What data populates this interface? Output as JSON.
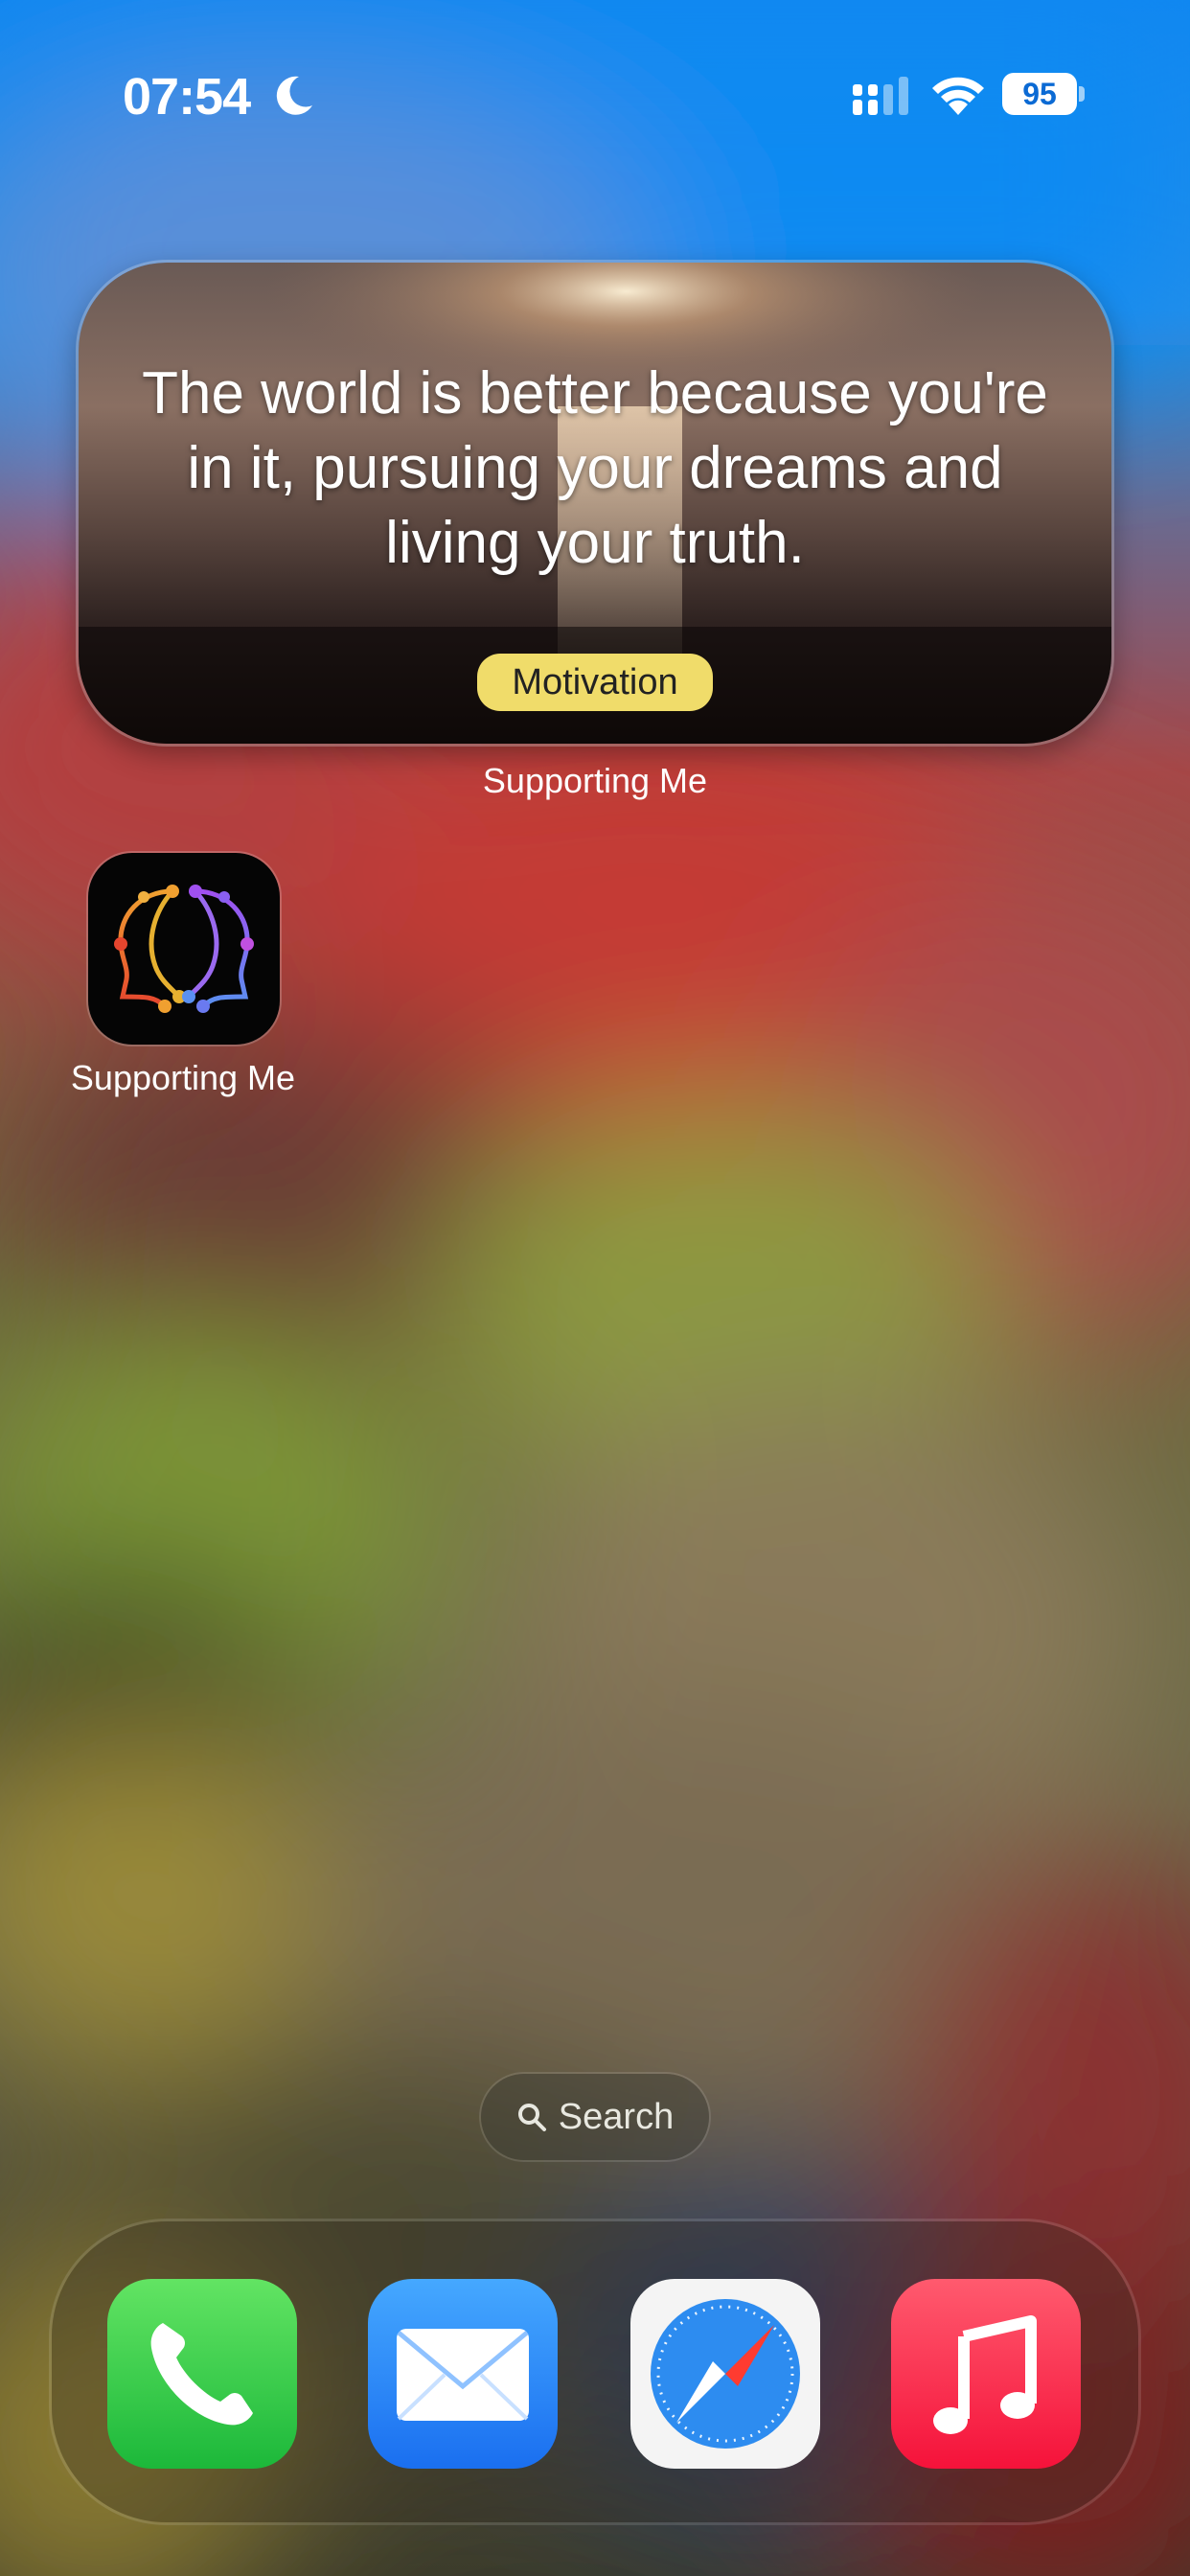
{
  "status_bar": {
    "time": "07:54",
    "battery_level": "95",
    "icons": [
      "moon-icon",
      "signal-icon",
      "wifi-icon",
      "battery-icon"
    ]
  },
  "widget": {
    "quote": "The world is better because you're in it, pursuing your dreams and living your truth.",
    "tag": "Motivation",
    "label": "Supporting Me"
  },
  "home_apps": [
    {
      "label": "Supporting Me",
      "icon": "supporting-me-app-icon"
    }
  ],
  "search": {
    "label": "Search",
    "icon": "search-icon"
  },
  "dock": {
    "apps": [
      {
        "name": "Phone",
        "icon": "phone-icon"
      },
      {
        "name": "Mail",
        "icon": "mail-icon"
      },
      {
        "name": "Safari",
        "icon": "safari-icon"
      },
      {
        "name": "Music",
        "icon": "music-icon"
      }
    ]
  },
  "colors": {
    "tag_background": "#f0dc6a",
    "phone_green": "#2fc745",
    "mail_blue": "#1f7bf2",
    "music_red": "#fa2d48"
  }
}
